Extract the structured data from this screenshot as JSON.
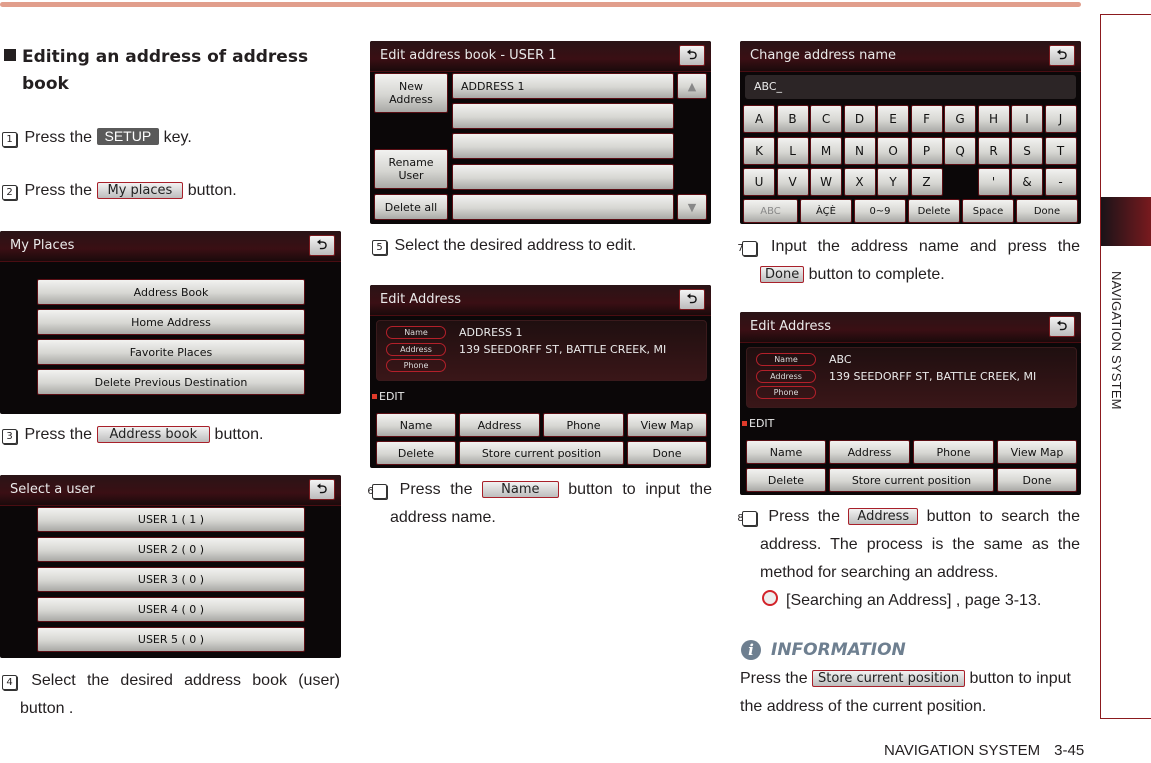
{
  "page": {
    "side_tab_label": "NAVIGATION SYSTEM",
    "footer_section": "NAVIGATION SYSTEM",
    "footer_page": "3-45"
  },
  "section_title": "Editing an address of address book",
  "steps": [
    {
      "num": "1",
      "pre": "Press the",
      "button": "SETUP",
      "post": "key."
    },
    {
      "num": "2",
      "pre": "Press the",
      "button": "My places",
      "post": "button."
    },
    {
      "num": "3",
      "pre": "Press the",
      "button": "Address book",
      "post": "button."
    },
    {
      "num": "4",
      "text": "Select the desired address book (user) button ."
    },
    {
      "num": "5",
      "text": "Select the desired address to edit."
    },
    {
      "num": "6",
      "pre": "Press the",
      "button": "Name",
      "post": "button to input the address name."
    },
    {
      "num": "7",
      "pre": "Input the address name and press the",
      "button": "Done",
      "post": "button to complete."
    },
    {
      "num": "8",
      "pre": "Press the",
      "button": "Address",
      "post": "button to search the address. The process is the same as the method for searching an address.",
      "reference": "[Searching an Address] , page 3-13."
    }
  ],
  "information": {
    "heading": "INFORMATION",
    "pre": "Press the",
    "button": "Store current position",
    "post": "button to input the address of the current position."
  },
  "screens": {
    "my_places": {
      "title": "My Places",
      "buttons": [
        "Address Book",
        "Home Address",
        "Favorite Places",
        "Delete Previous Destination"
      ]
    },
    "select_user": {
      "title": "Select a user",
      "buttons": [
        "USER 1 ( 1 )",
        "USER 2 ( 0 )",
        "USER 3 ( 0 )",
        "USER 4 ( 0 )",
        "USER 5 ( 0 )"
      ]
    },
    "edit_book": {
      "title": "Edit address book - USER 1",
      "new_address": "New Address",
      "rename_user": "Rename User",
      "delete_all": "Delete all",
      "rows": [
        "ADDRESS 1",
        "",
        "",
        "",
        ""
      ]
    },
    "edit_address_1": {
      "title": "Edit Address",
      "labels": [
        "Name",
        "Address",
        "Phone"
      ],
      "name_value": "ADDRESS 1",
      "address_value": "139 SEEDORFF ST, BATTLE CREEK, MI",
      "phone_value": "",
      "edit_label": "EDIT",
      "buttons_row1": [
        "Name",
        "Address",
        "Phone",
        "View Map"
      ],
      "buttons_row2": [
        "Delete",
        "Store current position",
        "Done"
      ]
    },
    "change_name": {
      "title": "Change address name",
      "input_value": "ABC_",
      "keys_row1": [
        "A",
        "B",
        "C",
        "D",
        "E",
        "F",
        "G",
        "H",
        "I",
        "J"
      ],
      "keys_row2": [
        "K",
        "L",
        "M",
        "N",
        "O",
        "P",
        "Q",
        "R",
        "S",
        "T"
      ],
      "keys_row3": [
        "U",
        "V",
        "W",
        "X",
        "Y",
        "Z",
        "",
        "'",
        "&",
        "-"
      ],
      "bottom_keys": [
        "ABC",
        "ÀÇÈ",
        "0~9",
        "Delete",
        "Space",
        "Done"
      ]
    },
    "edit_address_2": {
      "title": "Edit Address",
      "labels": [
        "Name",
        "Address",
        "Phone"
      ],
      "name_value": "ABC",
      "address_value": "139 SEEDORFF ST, BATTLE CREEK, MI",
      "phone_value": "",
      "edit_label": "EDIT",
      "buttons_row1": [
        "Name",
        "Address",
        "Phone",
        "View Map"
      ],
      "buttons_row2": [
        "Delete",
        "Store current position",
        "Done"
      ]
    }
  },
  "back_icon": "return-arrow-icon"
}
